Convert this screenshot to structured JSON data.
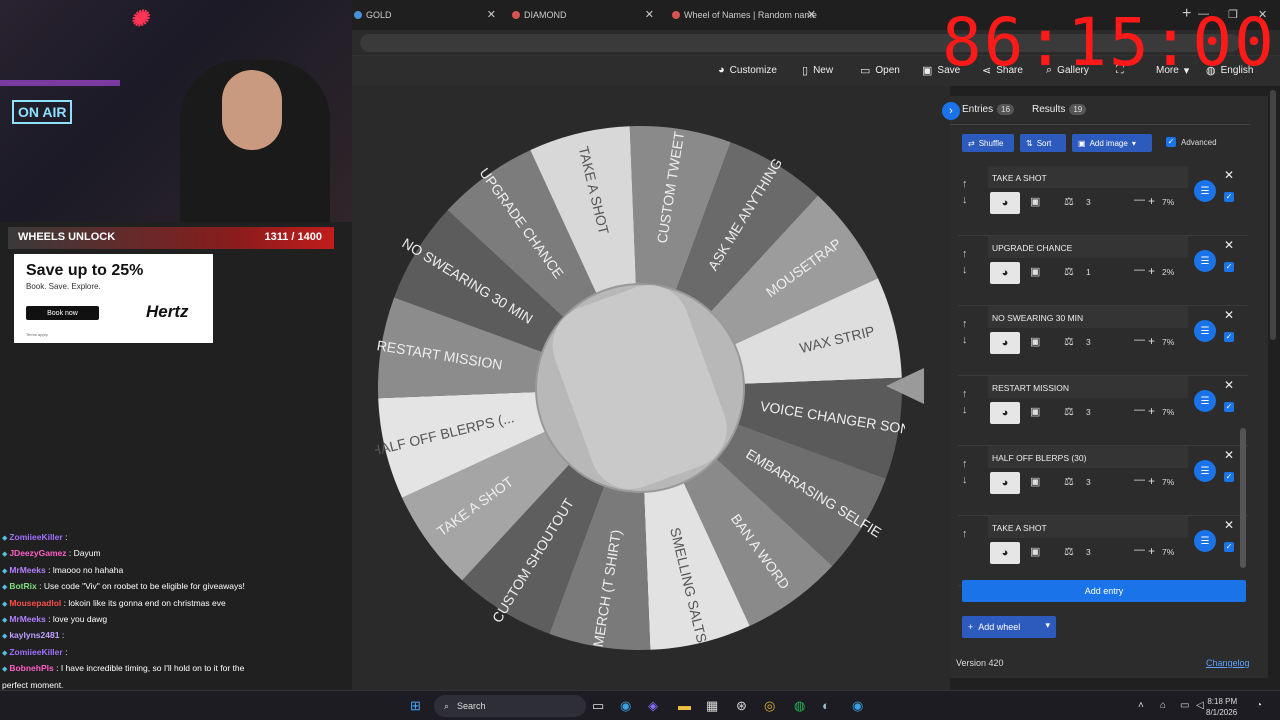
{
  "browser": {
    "tabs": [
      {
        "label": "GOLD",
        "icon": "gold-tab-icon"
      },
      {
        "label": "DIAMOND",
        "icon": "diamond-tab-icon"
      },
      {
        "label": "Wheel of Names | Random name",
        "icon": "wheel-tab-icon"
      }
    ]
  },
  "timer": "86:15:00",
  "toolbar": {
    "customize": "Customize",
    "new": "New",
    "open": "Open",
    "save": "Save",
    "share": "Share",
    "gallery": "Gallery",
    "more": "More",
    "language": "English"
  },
  "wheel": {
    "slices": [
      {
        "label": "CUSTOM TWEET",
        "shade": "#8a8a8a"
      },
      {
        "label": "ASK ME ANYTHING",
        "shade": "#6a6a6a"
      },
      {
        "label": "MOUSETRAP",
        "shade": "#9c9c9c"
      },
      {
        "label": "WAX STRIP",
        "shade": "#dedede"
      },
      {
        "label": "VOICE CHANGER SONG",
        "shade": "#5a5a5a"
      },
      {
        "label": "EMBARRASING SELFIE",
        "shade": "#6e6e6e"
      },
      {
        "label": "BAN A WORD",
        "shade": "#8a8a8a"
      },
      {
        "label": "SMELLING SALTS",
        "shade": "#e2e2e2"
      },
      {
        "label": "MERCH (T SHIRT)",
        "shade": "#7a7a7a"
      },
      {
        "label": "CUSTOM SHOUTOUT",
        "shade": "#5e5e5e"
      },
      {
        "label": "TAKE A SHOT",
        "shade": "#a5a5a5"
      },
      {
        "label": "HALF OFF BLERPS (...",
        "shade": "#e4e4e4"
      },
      {
        "label": "RESTART MISSION",
        "shade": "#8c8c8c"
      },
      {
        "label": "NO SWEARING 30 MIN",
        "shade": "#5c5c5c"
      },
      {
        "label": "UPGRADE CHANCE",
        "shade": "#7c7c7c"
      },
      {
        "label": "TAKE A SHOT",
        "shade": "#d8d8d8"
      }
    ]
  },
  "panel": {
    "entries_tab": "Entries",
    "entries_count": "16",
    "results_tab": "Results",
    "results_count": "19",
    "shuffle": "Shuffle",
    "sort": "Sort",
    "add_image": "Add image",
    "advanced": "Advanced",
    "items": [
      {
        "name": "TAKE A SHOT",
        "weight": "3",
        "pct": "7%"
      },
      {
        "name": "UPGRADE CHANCE",
        "weight": "1",
        "pct": "2%"
      },
      {
        "name": "NO SWEARING 30 MIN",
        "weight": "3",
        "pct": "7%"
      },
      {
        "name": "RESTART MISSION",
        "weight": "3",
        "pct": "7%"
      },
      {
        "name": "HALF OFF BLERPS (30)",
        "weight": "3",
        "pct": "7%"
      },
      {
        "name": "TAKE A SHOT",
        "weight": "3",
        "pct": "7%"
      }
    ],
    "add_entry": "Add entry",
    "add_wheel": "Add wheel",
    "version": "Version 420",
    "changelog": "Changelog"
  },
  "overlay": {
    "wheels_unlock": "WHEELS UNLOCK",
    "wheels_progress": "1311 / 1400",
    "on_air": "ON AIR"
  },
  "ad": {
    "headline": "Save up to 25%",
    "sub": "Book. Save. Explore.",
    "button": "Book now",
    "terms": "Terms apply.",
    "brand": "Hertz"
  },
  "chat": [
    {
      "user": "ZomiieeKiller",
      "color": "#a070ff",
      "text": ":"
    },
    {
      "user": "JDeezyGamez",
      "color": "#ff5ec8",
      "text": ": Dayum"
    },
    {
      "user": "MrMeeks",
      "color": "#b080ff",
      "text": ": lmaooo no hahaha"
    },
    {
      "user": "BotRix",
      "color": "#7fe07f",
      "text": ": Use code \"Viv\" on roobet to be eligible for giveaways!"
    },
    {
      "user": "Mousepadlol",
      "color": "#ff4d4d",
      "text": ": lokoin like its gonna end on christmas eve"
    },
    {
      "user": "MrMeeks",
      "color": "#b080ff",
      "text": ": love you dawg"
    },
    {
      "user": "kaylyns2481",
      "color": "#c0a0ff",
      "text": ":"
    },
    {
      "user": "ZomiieeKiller",
      "color": "#a070ff",
      "text": ":"
    },
    {
      "user": "BobnehPls",
      "color": "#ff5ec8",
      "text": ": I have incredible timing, so I'll hold on to it for the perfect moment."
    }
  ],
  "taskbar": {
    "search": "Search",
    "time": "8:18 PM",
    "date": "8/1/2026"
  }
}
